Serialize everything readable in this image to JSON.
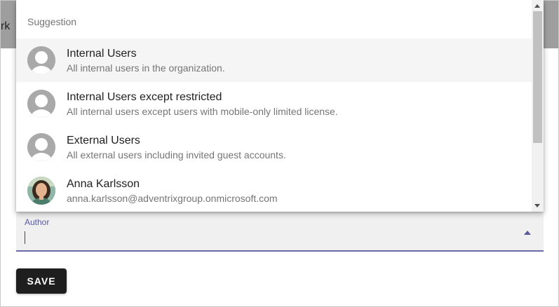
{
  "background": {
    "partial_text": "rk"
  },
  "author_field": {
    "label": "Author",
    "value": ""
  },
  "save_button": {
    "label": "SAVE"
  },
  "suggestions": {
    "header": "Suggestion",
    "items": [
      {
        "title": "Internal Users",
        "subtitle": "All internal users in the organization.",
        "avatar": "default-user-icon",
        "highlighted": true
      },
      {
        "title": "Internal Users except restricted",
        "subtitle": "All internal users except users with mobile-only limited license.",
        "avatar": "default-user-icon",
        "highlighted": false
      },
      {
        "title": "External Users",
        "subtitle": "All external users including invited guest accounts.",
        "avatar": "default-user-icon",
        "highlighted": false
      },
      {
        "title": "Anna Karlsson",
        "subtitle": "anna.karlsson@adventrixgroup.onmicrosoft.com",
        "avatar": "profile-photo",
        "highlighted": false
      }
    ]
  },
  "colors": {
    "accent": "#5a5aa0",
    "button_bg": "#1e1e1e",
    "highlight_row": "#f5f5f5",
    "header_bar": "#9e9e9e"
  }
}
